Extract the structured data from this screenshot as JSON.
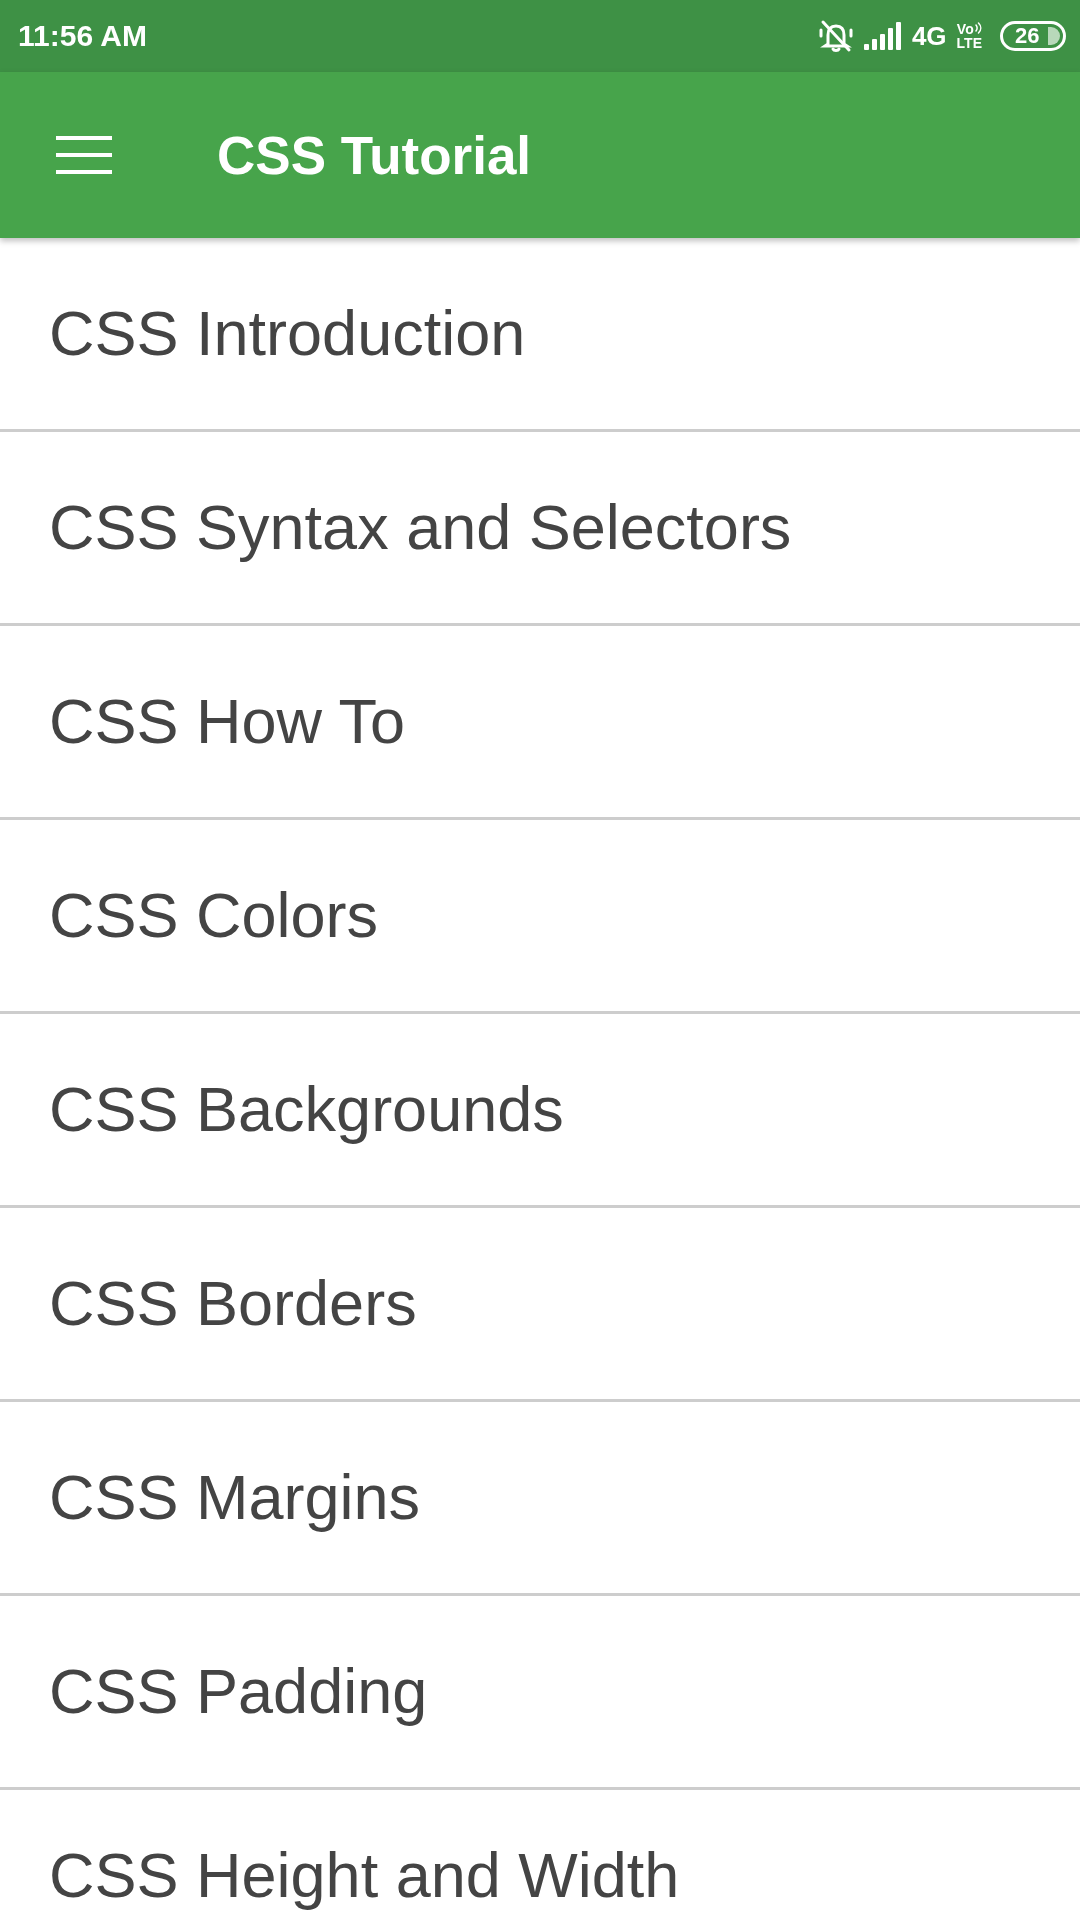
{
  "status_bar": {
    "time": "11:56 AM",
    "network": "4G",
    "volte_top": "Vo",
    "volte_bottom": "LTE",
    "battery": "26"
  },
  "app_bar": {
    "title": "CSS Tutorial"
  },
  "topics": [
    "CSS Introduction",
    "CSS Syntax and Selectors",
    "CSS How To",
    "CSS Colors",
    "CSS Backgrounds",
    "CSS Borders",
    "CSS Margins",
    "CSS Padding",
    "CSS Height and Width"
  ]
}
